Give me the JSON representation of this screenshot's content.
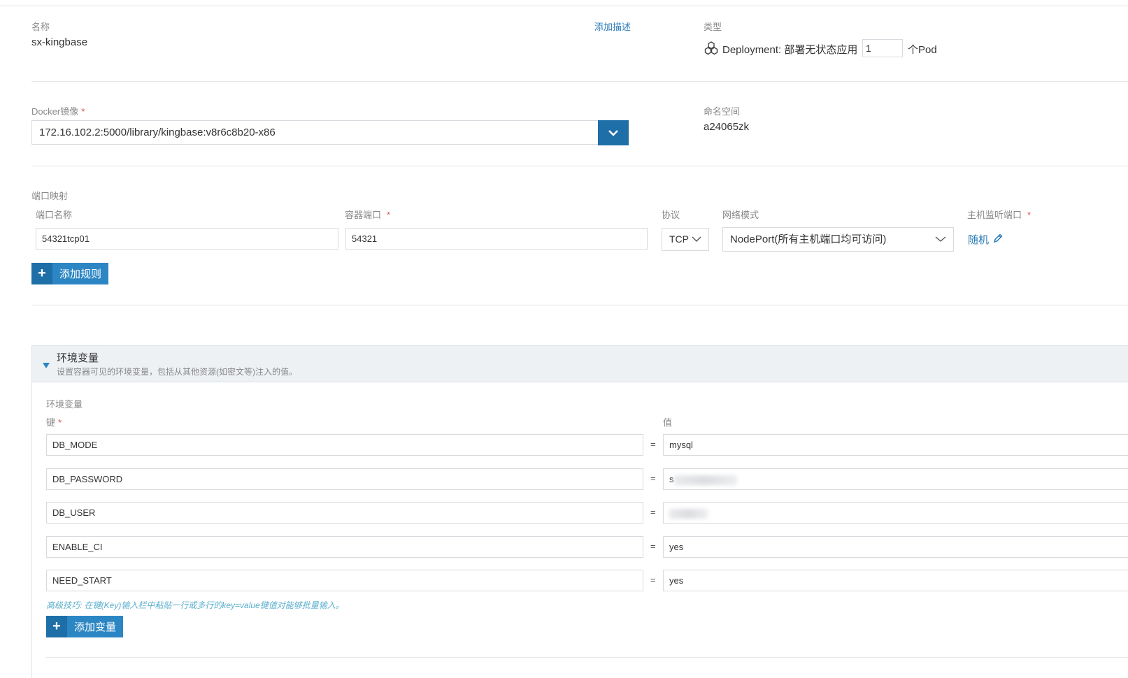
{
  "basic": {
    "name_label": "名称",
    "name_value": "sx-kingbase",
    "add_desc": "添加描述",
    "type_label": "类型",
    "type_value": "Deployment: 部署无状态应用",
    "pod_count": "1",
    "pod_suffix": "个Pod"
  },
  "image": {
    "label": "Docker镜像",
    "value": "172.16.102.2:5000/library/kingbase:v8r6c8b20-x86",
    "namespace_label": "命名空间",
    "namespace_value": "a24065zk"
  },
  "ports": {
    "section_label": "端口映射",
    "col_name": "端口名称",
    "col_container_port": "容器端口",
    "col_protocol": "协议",
    "col_network_mode": "网络模式",
    "col_host_port": "主机监听端口",
    "row": {
      "name": "54321tcp01",
      "container_port": "54321",
      "protocol": "TCP",
      "network_mode": "NodePort(所有主机端口均可访问)",
      "host_port": "随机"
    },
    "add_rule": "添加规则"
  },
  "env": {
    "title": "环境变量",
    "subtitle": "设置容器可见的环境变量，包括从其他资源(如密文等)注入的值。",
    "list_label": "环境变量",
    "key_label": "键",
    "value_label": "值",
    "eq": "=",
    "rows": [
      {
        "key": "DB_MODE",
        "value": "mysql"
      },
      {
        "key": "DB_PASSWORD",
        "value": "s"
      },
      {
        "key": "DB_USER",
        "value": ""
      },
      {
        "key": "ENABLE_CI",
        "value": "yes"
      },
      {
        "key": "NEED_START",
        "value": "yes"
      }
    ],
    "tip": "高级技巧: 在键(Key)输入栏中粘贴一行或多行的key=value键值对能够批量输入。",
    "add_var": "添加变量"
  },
  "colors": {
    "accent": "#2c86c4",
    "accent_dark": "#1e6ea7",
    "required": "#d9534f",
    "panel_header": "#eef1f4"
  }
}
